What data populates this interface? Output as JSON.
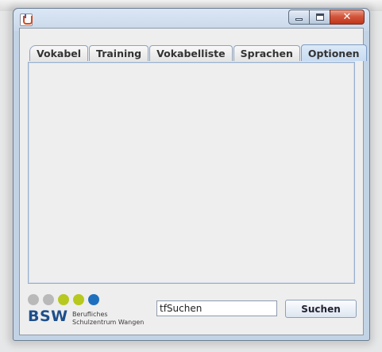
{
  "window": {
    "title": "",
    "controls": {
      "minimize": "",
      "maximize": "",
      "close": "✕"
    }
  },
  "tabs": [
    {
      "label": "Vokabel",
      "selected": false
    },
    {
      "label": "Training",
      "selected": false
    },
    {
      "label": "Vokabelliste",
      "selected": false
    },
    {
      "label": "Sprachen",
      "selected": false
    },
    {
      "label": "Optionen",
      "selected": true
    }
  ],
  "logo": {
    "dot_colors": [
      "#b9b9b9",
      "#b9b9b9",
      "#b7c81f",
      "#b7c81f",
      "#1f6fbf"
    ],
    "text": "BSW",
    "subtitle_line1": "Berufliches",
    "subtitle_line2": "Schulzentrum Wangen"
  },
  "search": {
    "value": "tfSuchen",
    "button_label": "Suchen"
  }
}
